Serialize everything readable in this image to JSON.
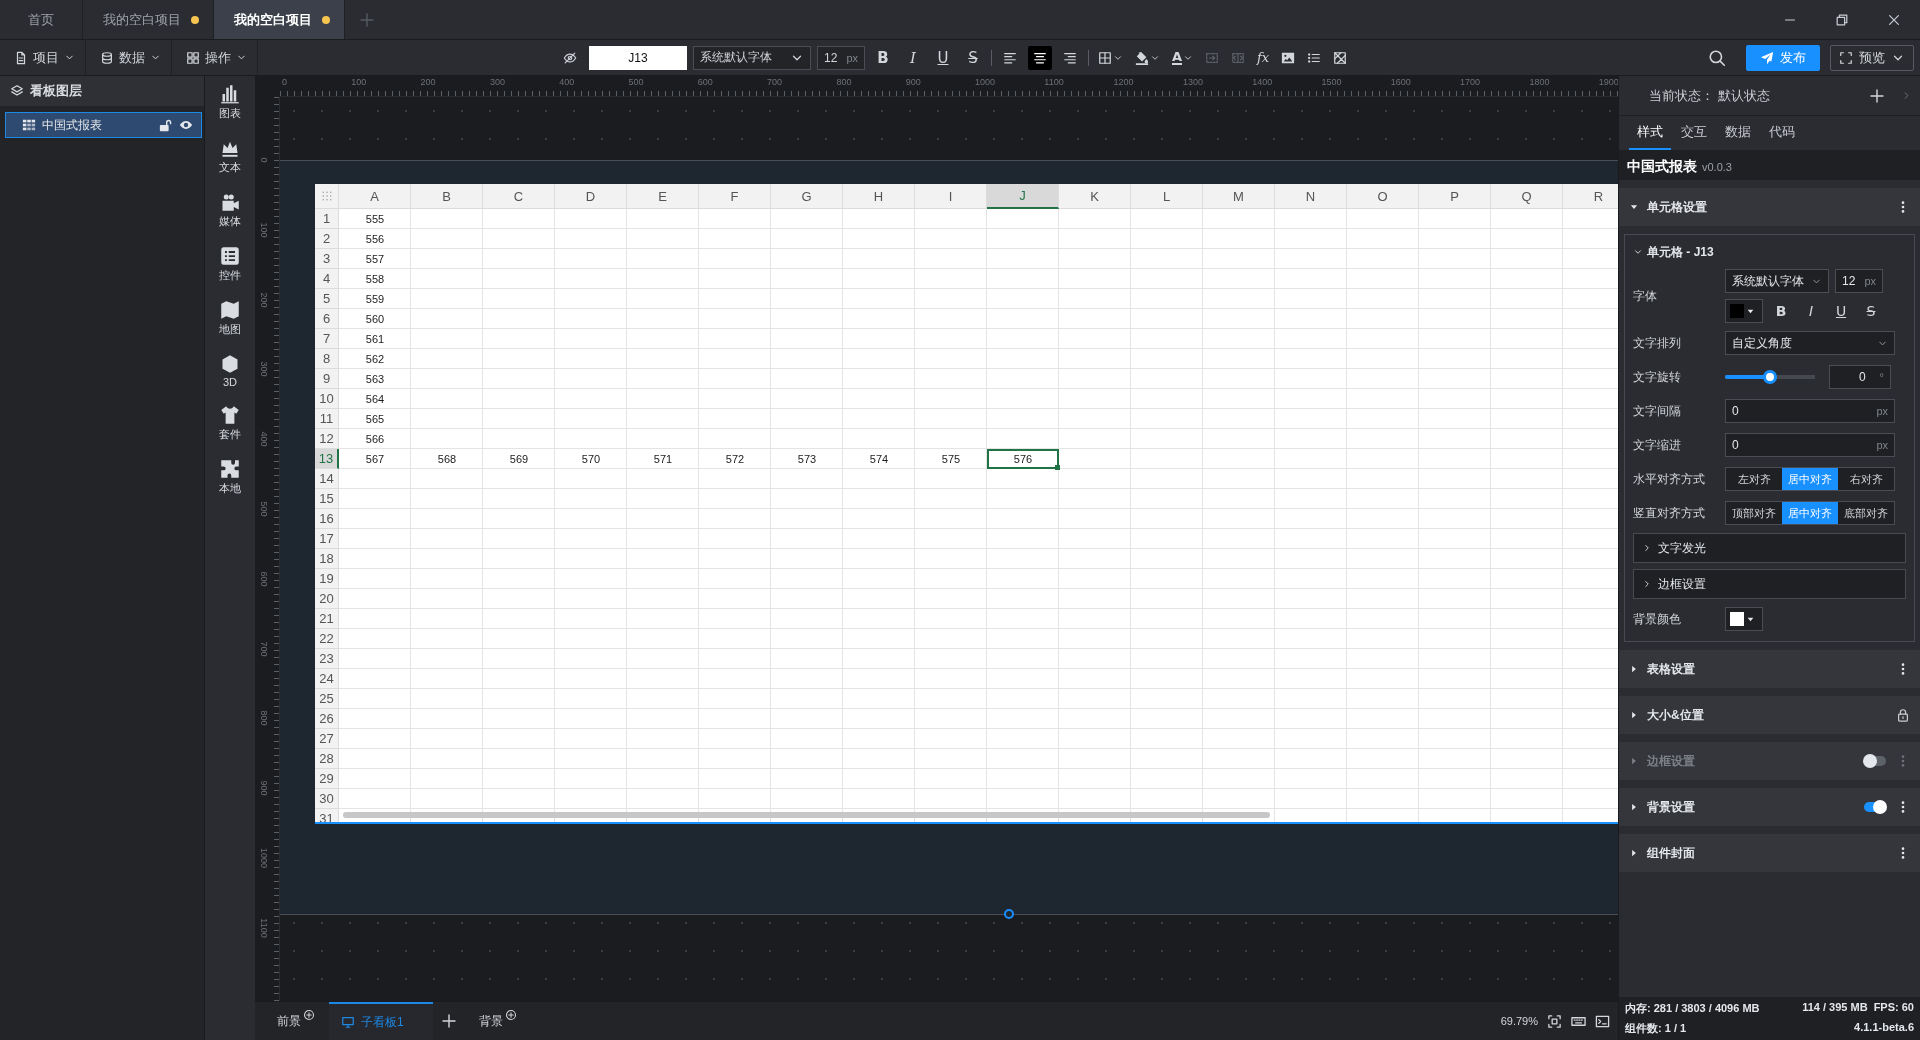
{
  "tabs": [
    {
      "label": "首页",
      "selected": false,
      "unsaved": false
    },
    {
      "label": "我的空白项目",
      "selected": false,
      "unsaved": true
    },
    {
      "label": "我的空白项目",
      "selected": true,
      "unsaved": true
    }
  ],
  "menus": [
    {
      "label": "项目",
      "kind": "file"
    },
    {
      "label": "数据",
      "kind": "database"
    },
    {
      "label": "操作",
      "kind": "grid"
    }
  ],
  "format_bar": {
    "cell_ref": "J13",
    "font_family": "系统默认字体",
    "font_size": "12",
    "size_unit": "px",
    "text_style": [
      {
        "kind": "bold",
        "glyph": "B"
      },
      {
        "kind": "italic",
        "glyph": "I"
      },
      {
        "kind": "underline",
        "glyph": "U"
      },
      {
        "kind": "strike",
        "glyph": "S"
      }
    ],
    "align": [
      {
        "kind": "left",
        "selected": false
      },
      {
        "kind": "center",
        "selected": true
      },
      {
        "kind": "right",
        "selected": false
      }
    ],
    "tools": [
      {
        "kind": "border",
        "disabled": false
      },
      {
        "kind": "fill",
        "disabled": false
      },
      {
        "kind": "font-color",
        "glyph": "A",
        "disabled": false
      },
      {
        "kind": "merge",
        "disabled": true
      },
      {
        "kind": "unmerge",
        "disabled": true
      },
      {
        "kind": "formula",
        "glyph": "fx",
        "disabled": false
      },
      {
        "kind": "image",
        "disabled": false
      },
      {
        "kind": "list",
        "disabled": false
      },
      {
        "kind": "clear",
        "disabled": false
      }
    ]
  },
  "actions": {
    "publish": "发布",
    "preview": "预览"
  },
  "layers_panel": {
    "title": "看板图层",
    "layers": [
      {
        "name": "中国式报表",
        "selected": true
      }
    ]
  },
  "widget_bar": [
    {
      "label": "图表",
      "kind": "chart"
    },
    {
      "label": "文本",
      "kind": "text"
    },
    {
      "label": "媒体",
      "kind": "media"
    },
    {
      "label": "控件",
      "kind": "control"
    },
    {
      "label": "地图",
      "kind": "map"
    },
    {
      "label": "3D",
      "kind": "cube"
    },
    {
      "label": "套件",
      "kind": "kit"
    },
    {
      "label": "本地",
      "kind": "local"
    }
  ],
  "rulers": {
    "horizontal": [
      "0",
      "100",
      "200",
      "300",
      "400",
      "500",
      "600",
      "700",
      "800",
      "900",
      "1000",
      "1100",
      "1200",
      "1300",
      "1400",
      "1500",
      "1600",
      "1700",
      "1800",
      "1900"
    ],
    "vertical": [
      "0",
      "100",
      "200",
      "300",
      "400",
      "500",
      "600",
      "700",
      "800",
      "900",
      "1000",
      "1100"
    ]
  },
  "sheet": {
    "columns": [
      {
        "label": "A",
        "selected": false
      },
      {
        "label": "B",
        "selected": false
      },
      {
        "label": "C",
        "selected": false
      },
      {
        "label": "D",
        "selected": false
      },
      {
        "label": "E",
        "selected": false
      },
      {
        "label": "F",
        "selected": false
      },
      {
        "label": "G",
        "selected": false
      },
      {
        "label": "H",
        "selected": false
      },
      {
        "label": "I",
        "selected": false
      },
      {
        "label": "J",
        "selected": true
      },
      {
        "label": "K",
        "selected": false
      },
      {
        "label": "L",
        "selected": false
      },
      {
        "label": "M",
        "selected": false
      },
      {
        "label": "N",
        "selected": false
      },
      {
        "label": "O",
        "selected": false
      },
      {
        "label": "P",
        "selected": false
      },
      {
        "label": "Q",
        "selected": false
      },
      {
        "label": "R",
        "selected": false
      }
    ],
    "rows": [
      {
        "label": "1",
        "selected": false,
        "cells": [
          "555"
        ]
      },
      {
        "label": "2",
        "selected": false,
        "cells": [
          "556"
        ]
      },
      {
        "label": "3",
        "selected": false,
        "cells": [
          "557"
        ]
      },
      {
        "label": "4",
        "selected": false,
        "cells": [
          "558"
        ]
      },
      {
        "label": "5",
        "selected": false,
        "cells": [
          "559"
        ]
      },
      {
        "label": "6",
        "selected": false,
        "cells": [
          "560"
        ]
      },
      {
        "label": "7",
        "selected": false,
        "cells": [
          "561"
        ]
      },
      {
        "label": "8",
        "selected": false,
        "cells": [
          "562"
        ]
      },
      {
        "label": "9",
        "selected": false,
        "cells": [
          "563"
        ]
      },
      {
        "label": "10",
        "selected": false,
        "cells": [
          "564"
        ]
      },
      {
        "label": "11",
        "selected": false,
        "cells": [
          "565"
        ]
      },
      {
        "label": "12",
        "selected": false,
        "cells": [
          "566"
        ]
      },
      {
        "label": "13",
        "selected": true,
        "cells": [
          "567",
          "568",
          "569",
          "570",
          "571",
          "572",
          "573",
          "574",
          "575",
          "576"
        ]
      },
      {
        "label": "14",
        "selected": false
      },
      {
        "label": "15",
        "selected": false
      },
      {
        "label": "16",
        "selected": false
      },
      {
        "label": "17",
        "selected": false
      },
      {
        "label": "18",
        "selected": false
      },
      {
        "label": "19",
        "selected": false
      },
      {
        "label": "20",
        "selected": false
      },
      {
        "label": "21",
        "selected": false
      },
      {
        "label": "22",
        "selected": false
      },
      {
        "label": "23",
        "selected": false
      },
      {
        "label": "24",
        "selected": false
      },
      {
        "label": "25",
        "selected": false
      },
      {
        "label": "26",
        "selected": false
      },
      {
        "label": "27",
        "selected": false
      },
      {
        "label": "28",
        "selected": false
      },
      {
        "label": "29",
        "selected": false
      },
      {
        "label": "30",
        "selected": false
      },
      {
        "label": "31",
        "selected": false
      }
    ]
  },
  "board_tabs": [
    {
      "label": "前景",
      "kind": "layer",
      "selected": false
    },
    {
      "label": "子看板1",
      "kind": "board",
      "selected": true
    },
    {
      "label": "背景",
      "kind": "layer",
      "selected": false
    }
  ],
  "zoom": "69.79%",
  "inspector": {
    "state_label": "当前状态：",
    "state_value": "默认状态",
    "tabs": [
      {
        "label": "样式",
        "selected": true
      },
      {
        "label": "交互",
        "selected": false
      },
      {
        "label": "数据",
        "selected": false
      },
      {
        "label": "代码",
        "selected": false
      }
    ],
    "component": {
      "name": "中国式报表",
      "version": "v0.0.3"
    },
    "cell_section": {
      "title": "单元格设置",
      "expanded": true,
      "group": {
        "title": "单元格 - J13",
        "expanded": true,
        "rows": [
          {
            "kind": "font",
            "label": "字体",
            "family": "系统默认字体",
            "size": "12",
            "unit": "px",
            "color": "#000000",
            "styles": [
              {
                "kind": "bold",
                "glyph": "B"
              },
              {
                "kind": "italic",
                "glyph": "I"
              },
              {
                "kind": "underline",
                "glyph": "U"
              },
              {
                "kind": "strike",
                "glyph": "S"
              }
            ]
          },
          {
            "kind": "select",
            "label": "文字排列",
            "value": "自定义角度"
          },
          {
            "kind": "slider",
            "label": "文字旋转",
            "level": 0.5,
            "value": "0",
            "unit": "°"
          },
          {
            "kind": "number",
            "label": "文字间隔",
            "value": "0",
            "unit": "px"
          },
          {
            "kind": "number",
            "label": "文字缩进",
            "value": "0",
            "unit": "px"
          },
          {
            "kind": "segmented",
            "label": "水平对齐方式",
            "options": [
              {
                "label": "左对齐",
                "selected": false
              },
              {
                "label": "居中对齐",
                "selected": true
              },
              {
                "label": "右对齐",
                "selected": false
              }
            ]
          },
          {
            "kind": "segmented",
            "label": "竖直对齐方式",
            "options": [
              {
                "label": "顶部对齐",
                "selected": false
              },
              {
                "label": "居中对齐",
                "selected": true
              },
              {
                "label": "底部对齐",
                "selected": false
              }
            ]
          },
          {
            "kind": "collapsible",
            "label": "文字发光",
            "expanded": false
          },
          {
            "kind": "collapsible",
            "label": "边框设置",
            "expanded": false
          },
          {
            "kind": "color",
            "label": "背景颜色",
            "color": "#ffffff"
          }
        ]
      }
    },
    "sections": [
      {
        "title": "表格设置",
        "expanded": false,
        "disabled": false,
        "kind": "menu"
      },
      {
        "title": "大小&位置",
        "expanded": false,
        "disabled": false,
        "kind": "lock"
      },
      {
        "title": "边框设置",
        "expanded": false,
        "disabled": true,
        "kind": "toggle",
        "on": false
      },
      {
        "title": "背景设置",
        "expanded": false,
        "disabled": false,
        "kind": "toggle",
        "on": true
      },
      {
        "title": "组件封面",
        "expanded": false,
        "disabled": false,
        "kind": "menu"
      }
    ]
  },
  "status": {
    "memory": "内存: 281 / 3803 / 4096 MB",
    "gpu_memory": "114 / 395 MB",
    "fps": "FPS: 60",
    "components": "组件数: 1 / 1",
    "version": "4.1.1-beta.6"
  }
}
